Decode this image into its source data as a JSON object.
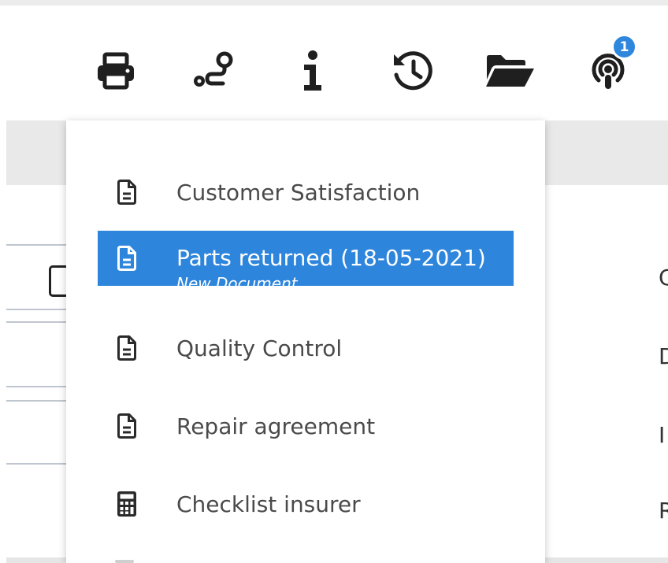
{
  "toolbar": {
    "icons": [
      "print-icon",
      "route-icon",
      "info-icon",
      "history-icon",
      "folder-open-icon",
      "podcast-icon"
    ],
    "notification_badge": "1",
    "accent_color": "#2e85dc"
  },
  "background": {
    "right_letters": [
      "C",
      "D",
      "I",
      "R"
    ]
  },
  "menu": {
    "items": [
      {
        "label": "Customer Satisfaction",
        "icon": "document-icon"
      },
      {
        "label": "Parts returned (18-05-2021)",
        "sublabel": "New Document",
        "icon": "document-icon",
        "selected": true
      },
      {
        "label": "Quality Control",
        "icon": "document-icon"
      },
      {
        "label": "Repair agreement",
        "icon": "document-icon"
      },
      {
        "label": "Checklist insurer",
        "icon": "calculator-icon"
      }
    ]
  }
}
